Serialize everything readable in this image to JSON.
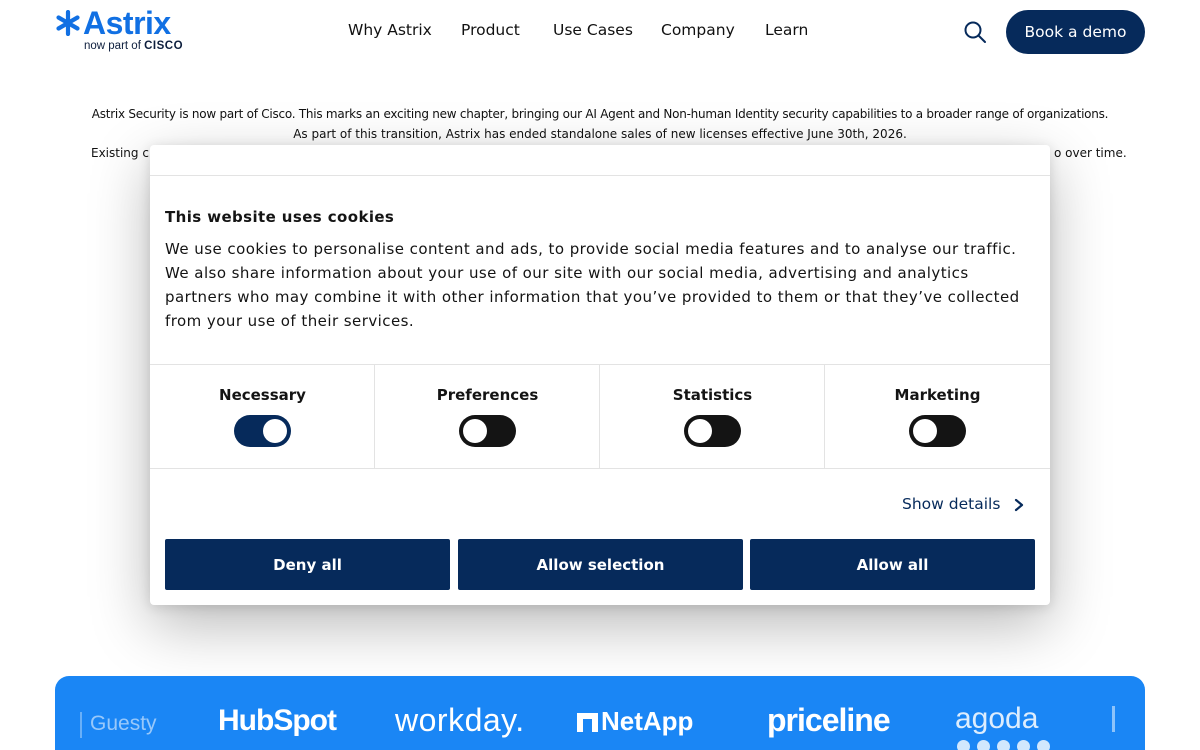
{
  "header": {
    "logo_text": "Astrix",
    "logo_subtext": "now part of",
    "logo_parent": "CISCO",
    "nav": [
      "Why Astrix",
      "Product",
      "Use Cases",
      "Company",
      "Learn"
    ],
    "search_icon": "search-icon",
    "cta_label": "Book a demo"
  },
  "announcement": {
    "line1": "Astrix Security is now part of Cisco. This marks an exciting new chapter, bringing our AI Agent and Non-human Identity security capabilities to a broader range of organizations.",
    "line2": "As part of this transition, Astrix has ended standalone sales of new licenses effective June 30th, 2026.",
    "line3_start": "Existing cu",
    "line3_end": "o over time."
  },
  "cookie_dialog": {
    "title": "This website uses cookies",
    "body": "We use cookies to personalise content and ads, to provide social media features and to analyse our traffic. We also share information about your use of our site with our social media, advertising and analytics partners who may combine it with other information that you’ve provided to them or that they’ve collected from your use of their services.",
    "toggles": [
      {
        "label": "Necessary",
        "state": "on"
      },
      {
        "label": "Preferences",
        "state": "off"
      },
      {
        "label": "Statistics",
        "state": "off"
      },
      {
        "label": "Marketing",
        "state": "off"
      }
    ],
    "show_details": "Show details",
    "buttons": {
      "deny": "Deny all",
      "selection": "Allow selection",
      "allow": "Allow all"
    }
  },
  "customer_logos": [
    "Guesty",
    "HubSpot",
    "workday.",
    "NetApp",
    "priceline",
    "agoda"
  ],
  "colors": {
    "brand_blue": "#1170e3",
    "navy": "#062a5b",
    "strip_blue": "#1a86f5"
  }
}
